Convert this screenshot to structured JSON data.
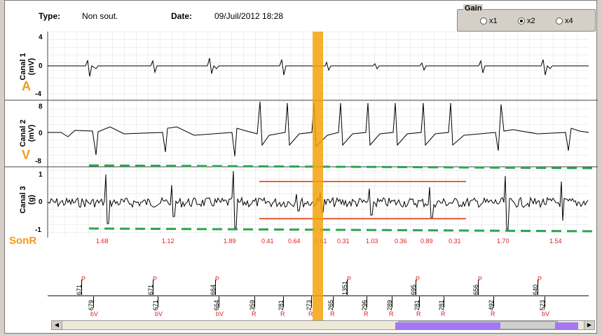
{
  "header": {
    "type_label": "Type:",
    "type_value": "Non sout.",
    "date_label": "Date:",
    "date_value": "09/Juil/2012 18:28"
  },
  "gain": {
    "title": "Gain",
    "options": [
      {
        "label": "x1",
        "selected": false
      },
      {
        "label": "x2",
        "selected": true
      },
      {
        "label": "x4",
        "selected": false
      }
    ]
  },
  "channels": [
    {
      "label": "Canal 1\n(mV)",
      "marker": "A",
      "scale_top": "4",
      "scale_mid": "0",
      "scale_bot": "-4"
    },
    {
      "label": "Canal 2\n(mV)",
      "marker": "V",
      "scale_top": "8",
      "scale_mid": "0",
      "scale_bot": "-8"
    },
    {
      "label": "Canal 3\n(g)",
      "marker": "SonR",
      "scale_top": "1",
      "scale_mid": "0",
      "scale_bot": "-1"
    }
  ],
  "sonr_values": [
    "1.68",
    "1.12",
    "1.89",
    "0.41",
    "0.64",
    "0.41",
    "0.31",
    "1.03",
    "0.36",
    "0.89",
    "0.31",
    "1.70",
    "1.54"
  ],
  "markers": {
    "upper": [
      {
        "num": "671",
        "tag": "P"
      },
      {
        "num": "671",
        "tag": "P"
      },
      {
        "num": "664",
        "tag": "P"
      },
      {
        "num": "1351",
        "tag": "P"
      },
      {
        "num": "695",
        "tag": "P"
      },
      {
        "num": "656",
        "tag": "P"
      },
      {
        "num": "640",
        "tag": "P"
      }
    ],
    "lower": [
      {
        "num": "679",
        "tag": "bV"
      },
      {
        "num": "671",
        "tag": "bV"
      },
      {
        "num": "664",
        "tag": "bV"
      },
      {
        "num": "359",
        "tag": "R"
      },
      {
        "num": "281",
        "tag": "R"
      },
      {
        "num": "273",
        "tag": "R"
      },
      {
        "num": "265",
        "tag": "R"
      },
      {
        "num": "296",
        "tag": "R"
      },
      {
        "num": "289",
        "tag": "R"
      },
      {
        "num": "281",
        "tag": "R"
      },
      {
        "num": "281",
        "tag": "R"
      },
      {
        "num": "492",
        "tag": "R"
      },
      {
        "num": "523",
        "tag": "bV"
      }
    ]
  },
  "colors": {
    "cursor": "#f5a20c",
    "guide_green": "#2ea44f",
    "guide_orange": "#e0643a",
    "red_text": "#e31b1b",
    "scroll_purple": "#a378f2"
  }
}
